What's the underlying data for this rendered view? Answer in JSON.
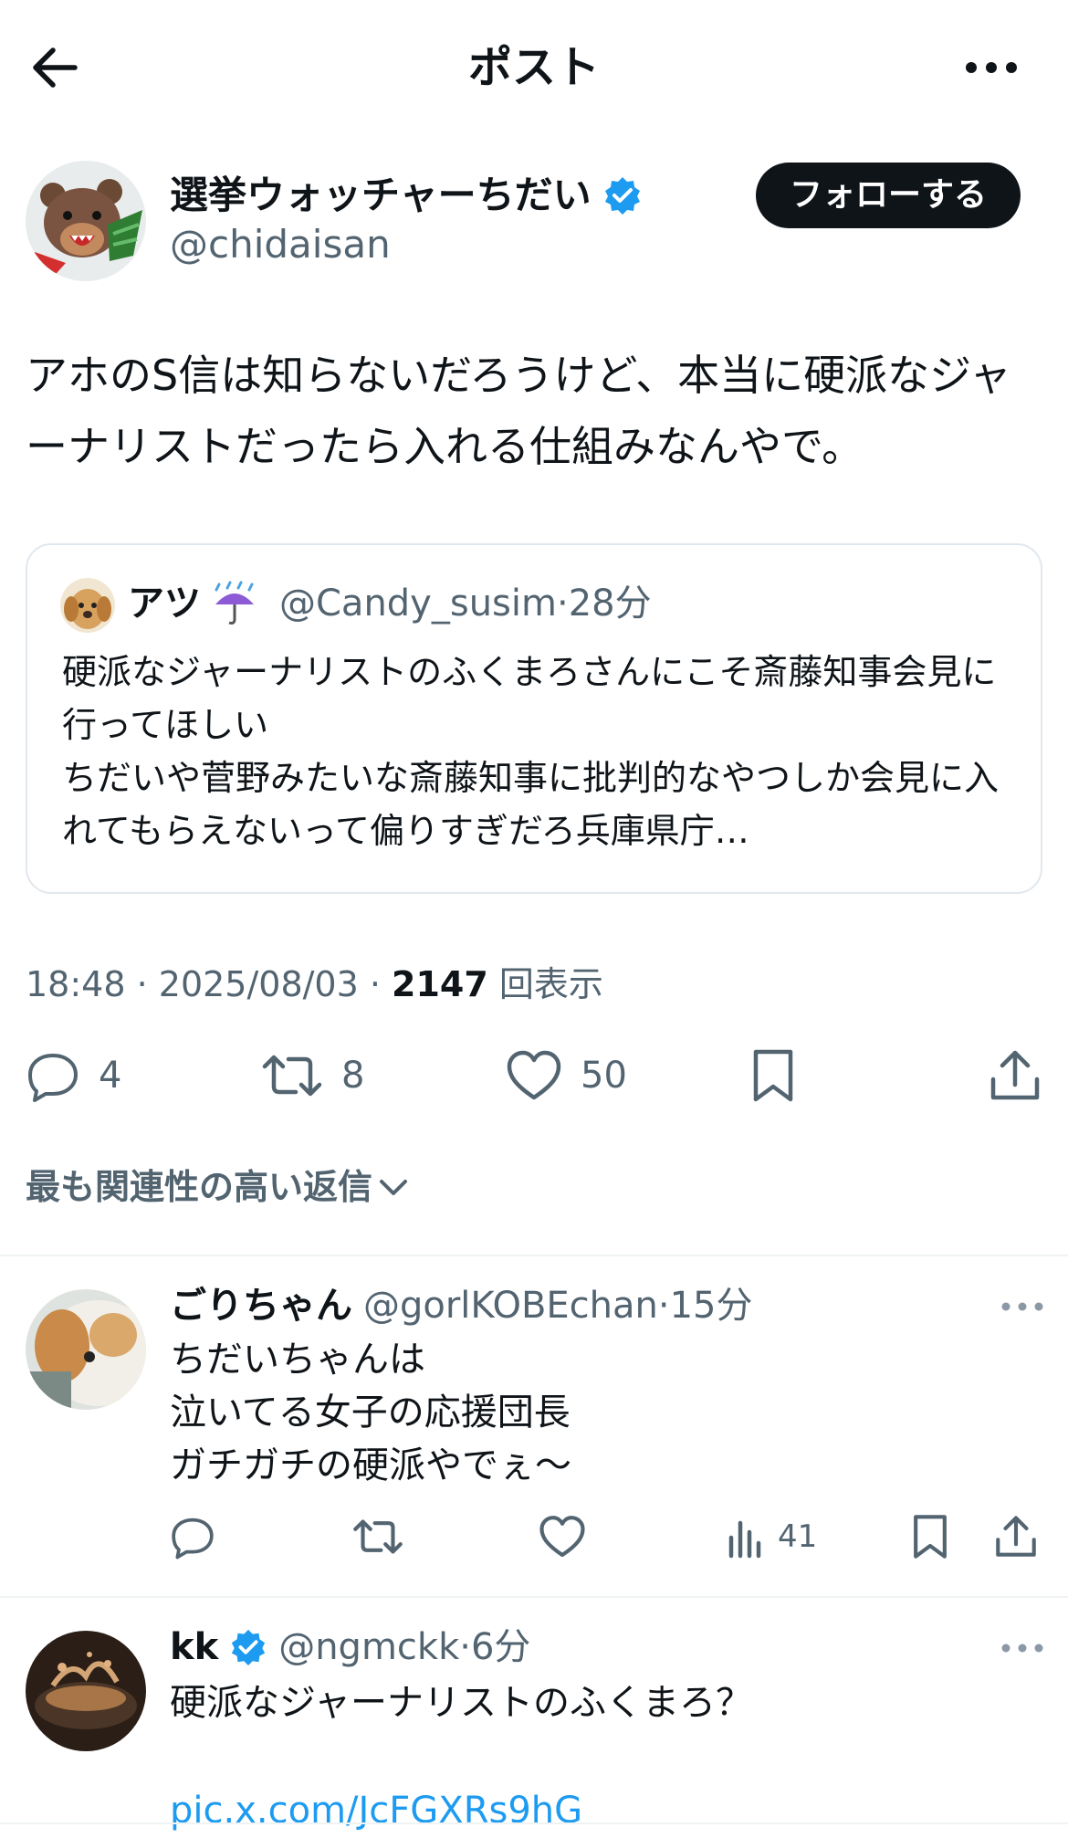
{
  "header": {
    "title": "ポスト"
  },
  "post": {
    "author_name": "選挙ウォッチャーちだい",
    "author_handle": "@chidaisan",
    "follow_label": "フォローする",
    "text": "アホのS信は知らないだろうけど、本当に硬派なジャーナリストだったら入れる仕組みなんやで。",
    "quote": {
      "name": "アツ",
      "handle": "@Candy_susim",
      "time": "28分",
      "text": "硬派なジャーナリストのふくまろさんにこそ斎藤知事会見に行ってほしい\nちだいや菅野みたいな斎藤知事に批判的なやつしか会見に入れてもらえないって偏りすぎだろ兵庫県庁…"
    },
    "time": "18:48",
    "date": "2025/08/03",
    "views": "2147",
    "views_label": "回表示",
    "replies": "4",
    "reposts": "8",
    "likes": "50"
  },
  "sort_label": "最も関連性の高い返信",
  "replies": [
    {
      "name": "ごりちゃん",
      "handle": "@gorlKOBEchan",
      "time": "15分",
      "text": "ちだいちゃんは\n泣いてる女子の応援団長\nガチガチの硬派やでぇ〜",
      "views": "41"
    },
    {
      "name": "kk",
      "handle": "@ngmckk",
      "time": "6分",
      "text": "硬派なジャーナリストのふくまろ？",
      "link": "pic.x.com/JcFGXRs9hG"
    }
  ],
  "colors": {
    "accent": "#1d9bf0",
    "text": "#0f1419",
    "muted": "#536471",
    "verified": "#1d9bf0"
  },
  "icons": [
    "back-arrow-icon",
    "more-icon",
    "verified-icon",
    "reply-icon",
    "repost-icon",
    "like-icon",
    "bookmark-icon",
    "share-icon",
    "views-icon",
    "chevron-down-icon"
  ]
}
